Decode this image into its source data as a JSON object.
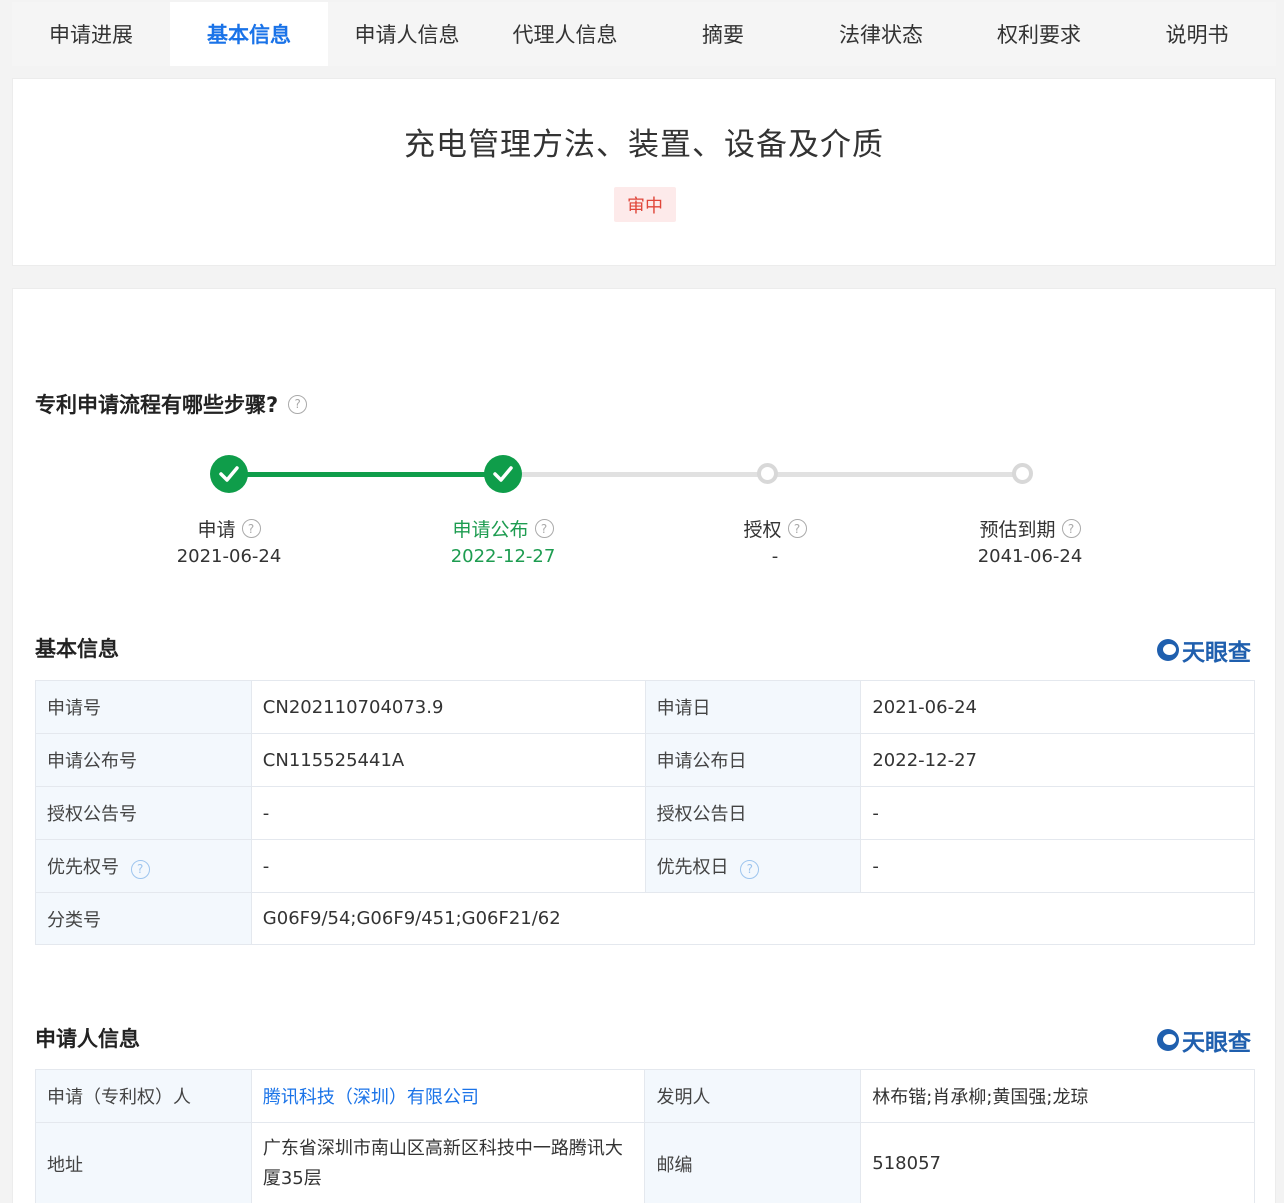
{
  "tabs": [
    "申请进展",
    "基本信息",
    "申请人信息",
    "代理人信息",
    "摘要",
    "法律状态",
    "权利要求",
    "说明书"
  ],
  "title": "充电管理方法、装置、设备及介质",
  "status_badge": "审中",
  "process": {
    "heading": "专利申请流程有哪些步骤?",
    "steps": [
      {
        "label": "申请",
        "date": "2021-06-24",
        "state": "done"
      },
      {
        "label": "申请公布",
        "date": "2022-12-27",
        "state": "current"
      },
      {
        "label": "授权",
        "date": "-",
        "state": "pending"
      },
      {
        "label": "预估到期",
        "date": "2041-06-24",
        "state": "pending"
      }
    ]
  },
  "brand": "天眼查",
  "basic": {
    "heading": "基本信息",
    "rows": [
      {
        "k1": "申请号",
        "v1": "CN202110704073.9",
        "k2": "申请日",
        "v2": "2021-06-24"
      },
      {
        "k1": "申请公布号",
        "v1": "CN115525441A",
        "k2": "申请公布日",
        "v2": "2022-12-27"
      },
      {
        "k1": "授权公告号",
        "v1": "-",
        "k2": "授权公告日",
        "v2": "-"
      },
      {
        "k1": "优先权号",
        "v1": "-",
        "k2": "优先权日",
        "v2": "-"
      }
    ],
    "class_label": "分类号",
    "class_value": "G06F9/54;G06F9/451;G06F21/62"
  },
  "applicant": {
    "heading": "申请人信息",
    "applicant_label": "申请（专利权）人",
    "applicant_value": "腾讯科技（深圳）有限公司",
    "inventor_label": "发明人",
    "inventor_value": "林布锴;肖承柳;黄国强;龙琼",
    "address_label": "地址",
    "address_value": "广东省深圳市南山区高新区科技中一路腾讯大厦35层",
    "postcode_label": "邮编",
    "postcode_value": "518057"
  }
}
